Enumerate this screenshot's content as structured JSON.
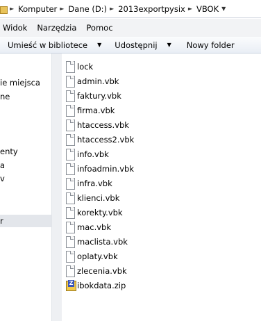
{
  "address_bar": {
    "crumbs": [
      "Komputer",
      "Dane (D:)",
      "2013exportpysix",
      "VBOK"
    ]
  },
  "menu_bar": {
    "items": [
      "Widok",
      "Narzędzia",
      "Pomoc"
    ]
  },
  "command_bar": {
    "include_in_library": "Umieść w bibliotece",
    "share": "Udostępnij",
    "new_folder": "Nowy folder"
  },
  "nav_pane": {
    "items": [
      "ie miejsca",
      "ne",
      "enty",
      "a",
      "v",
      "r"
    ],
    "selected_index": 5
  },
  "files": [
    {
      "name": "lock",
      "icon": "document-icon"
    },
    {
      "name": "admin.vbk",
      "icon": "document-icon"
    },
    {
      "name": "faktury.vbk",
      "icon": "document-icon"
    },
    {
      "name": "firma.vbk",
      "icon": "document-icon"
    },
    {
      "name": "htaccess.vbk",
      "icon": "document-icon"
    },
    {
      "name": "htaccess2.vbk",
      "icon": "document-icon"
    },
    {
      "name": "info.vbk",
      "icon": "document-icon"
    },
    {
      "name": "infoadmin.vbk",
      "icon": "document-icon"
    },
    {
      "name": "infra.vbk",
      "icon": "document-icon"
    },
    {
      "name": "klienci.vbk",
      "icon": "document-icon"
    },
    {
      "name": "korekty.vbk",
      "icon": "document-icon"
    },
    {
      "name": "mac.vbk",
      "icon": "document-icon"
    },
    {
      "name": "maclista.vbk",
      "icon": "document-icon"
    },
    {
      "name": "oplaty.vbk",
      "icon": "document-icon"
    },
    {
      "name": "zlecenia.vbk",
      "icon": "document-icon"
    },
    {
      "name": "ibokdata.zip",
      "icon": "zip-archive-icon"
    }
  ]
}
